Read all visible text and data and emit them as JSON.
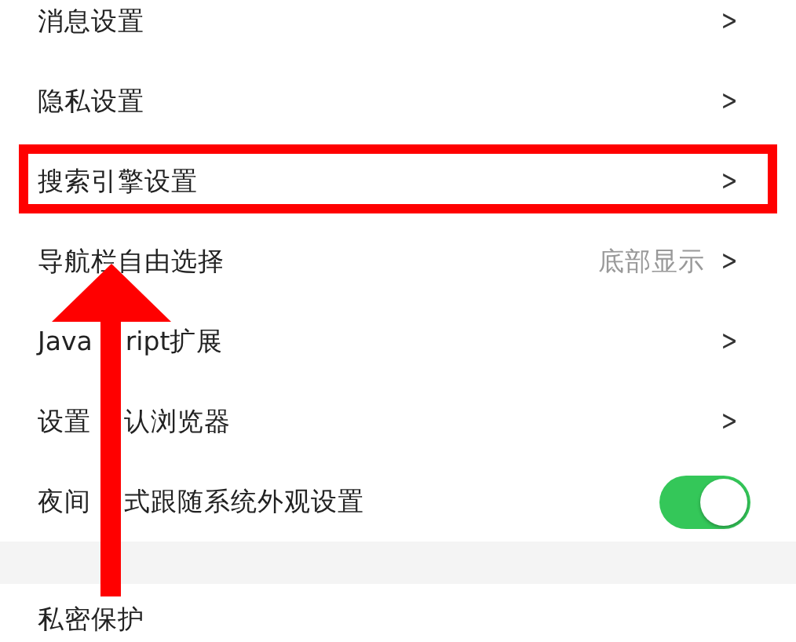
{
  "settings": [
    {
      "kind": "link",
      "label": "消息设置",
      "chevron": ">"
    },
    {
      "kind": "link",
      "label": "隐私设置",
      "chevron": ">"
    },
    {
      "kind": "link",
      "label": "搜索引擎设置",
      "chevron": ">",
      "highlighted": true
    },
    {
      "kind": "link",
      "label": "导航栏自由选择",
      "value": "底部显示",
      "chevron": ">"
    },
    {
      "kind": "link",
      "label": [
        "Java",
        "ript扩展"
      ],
      "chevron": ">"
    },
    {
      "kind": "link",
      "label": [
        "设置",
        "认浏览器"
      ],
      "chevron": ">"
    },
    {
      "kind": "toggle",
      "label": [
        "夜间",
        "式跟随系统外观设置"
      ],
      "on": true
    }
  ],
  "section_2": [
    {
      "label": "私密保护"
    }
  ]
}
